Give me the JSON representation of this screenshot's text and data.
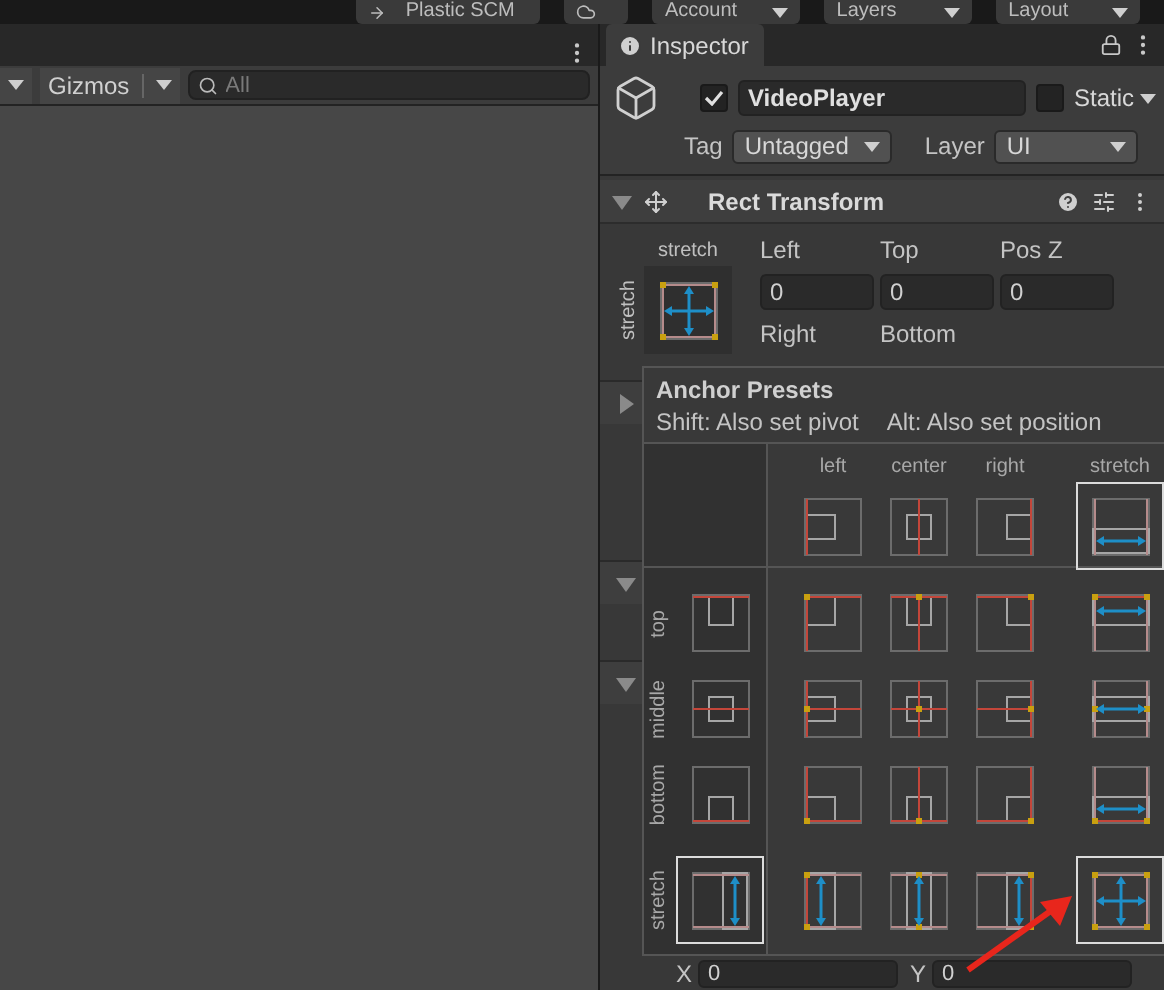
{
  "toolbar": {
    "buttons": [
      {
        "label": "Plastic SCM",
        "kind": "scm"
      },
      {
        "kind": "cloud"
      },
      {
        "label": "Account",
        "kind": "dropdown"
      },
      {
        "label": "Layers",
        "kind": "dropdown"
      },
      {
        "label": "Layout",
        "kind": "dropdown"
      }
    ]
  },
  "scene": {
    "gizmos": "Gizmos",
    "search": {
      "placeholder": "All"
    }
  },
  "inspector": {
    "tab": "Inspector",
    "object": {
      "active": true,
      "name": "VideoPlayer",
      "static": false,
      "static_label": "Static",
      "tag_label": "Tag",
      "tag": "Untagged",
      "layer_label": "Layer",
      "layer": "UI"
    },
    "component": {
      "title": "Rect Transform",
      "expanded": true,
      "anchor_h_label": "stretch",
      "anchor_v_label": "stretch",
      "fields": [
        {
          "label": "Left",
          "value": "0"
        },
        {
          "label": "Top",
          "value": "0"
        },
        {
          "label": "Pos Z",
          "value": "0"
        },
        {
          "label": "Right"
        },
        {
          "label": "Bottom"
        }
      ]
    },
    "position": [
      {
        "label": "X",
        "value": "0"
      },
      {
        "label": "Y",
        "value": "0"
      }
    ]
  },
  "anchor_presets": {
    "title": "Anchor Presets",
    "hints": [
      "Shift: Also set pivot",
      "Alt: Also set position"
    ],
    "columns": [
      {
        "label": "left",
        "selected": false
      },
      {
        "label": "center",
        "selected": false
      },
      {
        "label": "right",
        "selected": false
      },
      {
        "label": "stretch",
        "selected": true
      }
    ],
    "rows": [
      {
        "label": "top",
        "selected": false,
        "cells": [
          {
            "selected": false
          },
          {
            "selected": false
          },
          {
            "selected": false
          },
          {
            "selected": false
          }
        ]
      },
      {
        "label": "middle",
        "selected": false,
        "cells": [
          {
            "selected": false
          },
          {
            "selected": false
          },
          {
            "selected": false
          },
          {
            "selected": false
          }
        ]
      },
      {
        "label": "bottom",
        "selected": false,
        "cells": [
          {
            "selected": false
          },
          {
            "selected": false
          },
          {
            "selected": false
          },
          {
            "selected": false
          }
        ]
      },
      {
        "label": "stretch",
        "selected": true,
        "cells": [
          {
            "selected": false
          },
          {
            "selected": false
          },
          {
            "selected": false
          },
          {
            "selected": true
          }
        ]
      }
    ]
  }
}
